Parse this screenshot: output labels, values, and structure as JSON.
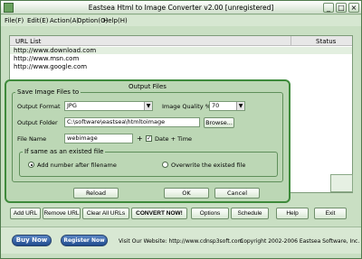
{
  "window": {
    "title": "Eastsea Html to Image Converter v2.00 [unregistered]",
    "minimize": "_",
    "maximize": "□",
    "close": "×"
  },
  "menu": [
    "File(F)",
    "Edit(E)",
    "Action(A)",
    "Option(O)",
    "Help(H)"
  ],
  "url_list": {
    "header_url": "URL List",
    "header_status": "Status",
    "rows": [
      "http://www.download.com",
      "http://www.msn.com",
      "http://www.google.com"
    ]
  },
  "toolbar": [
    "Add URL",
    "Remove URL",
    "Clear All URLs",
    "CONVERT NOW!",
    "Options",
    "Schedule",
    "Help",
    "Exit"
  ],
  "footer": {
    "buy": "Buy Now",
    "register": "Register Now",
    "visit": "Visit Our Website: http://www.cdnsp3soft.com",
    "copyright": "Copyright 2002-2006 Eastsea Software, Inc."
  },
  "dialog": {
    "title": "Output Files",
    "group_save": "Save Image Files to",
    "output_format_label": "Output Format",
    "output_format_value": "JPG",
    "quality_label": "Image Quality %",
    "quality_value": "70",
    "folder_label": "Output Folder",
    "folder_value": "C:\\software\\eastsea\\htmltoimage",
    "browse": "Browse...",
    "file_name_label": "File Name",
    "file_name_value": "webimage",
    "plus": "+",
    "date_time_checked": true,
    "date_time_label": "Date + Time",
    "group_exists": "If same as an existed file",
    "radio_add": "Add number after filename",
    "radio_overwrite": "Overwrite the existed file",
    "reload": "Reload",
    "ok": "OK",
    "cancel": "Cancel"
  },
  "colors": {
    "window_bg": "#c9dfc3",
    "dialog_bg": "#bcd7b5",
    "dialog_border": "#3e8a3b",
    "pill_blue": "#1f4b8e"
  }
}
